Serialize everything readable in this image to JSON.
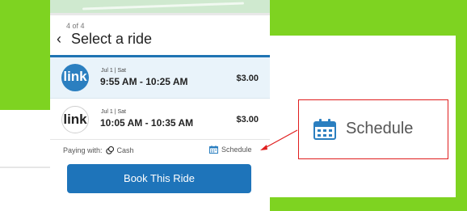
{
  "screen": {
    "step": "4 of 4",
    "back_glyph": "‹",
    "title": "Select a ride"
  },
  "rides": [
    {
      "logo": "link",
      "date": "Jul 1 | Sat",
      "time": "9:55 AM - 10:25 AM",
      "price": "$3.00",
      "selected": true
    },
    {
      "logo": "link",
      "date": "Jul 1 | Sat",
      "time": "10:05 AM - 10:35 AM",
      "price": "$3.00",
      "selected": false
    }
  ],
  "payment": {
    "label": "Paying with:",
    "method": "Cash",
    "schedule_label": "Schedule"
  },
  "book_button": {
    "label": "Book This Ride"
  },
  "callout": {
    "label": "Schedule"
  },
  "colors": {
    "frame_green": "#7ed321",
    "accent_blue": "#1f74b3",
    "button_blue": "#1e74ba",
    "selected_row": "#e9f3fa",
    "callout_red": "#e01e1e"
  },
  "icons": {
    "calendar": "calendar-icon",
    "cash": "cash-icon",
    "back": "chevron-left-icon"
  }
}
